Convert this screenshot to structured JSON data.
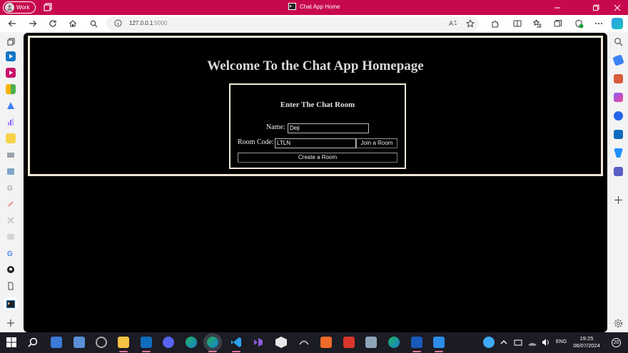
{
  "browser": {
    "profile_label": "Work",
    "window_title": "Chat App Home",
    "url_host": "127.0.0.1",
    "url_port": ":5000"
  },
  "page": {
    "heading": "Welcome To the Chat App Homepage",
    "card_title": "Enter The Chat Room",
    "name_label": "Name:",
    "name_value": "Deji",
    "room_code_label": "Room Code:",
    "room_code_value": "LTLN",
    "join_button": "Join a Room",
    "create_button": "Create a Room"
  },
  "taskbar": {
    "time": "19:25",
    "date": "06/07/2024",
    "language": "ENG",
    "notification_count": "20"
  },
  "colors": {
    "title_bar": "#c8084e",
    "page_background": "#000000",
    "panel_border": "#efe7d6"
  }
}
